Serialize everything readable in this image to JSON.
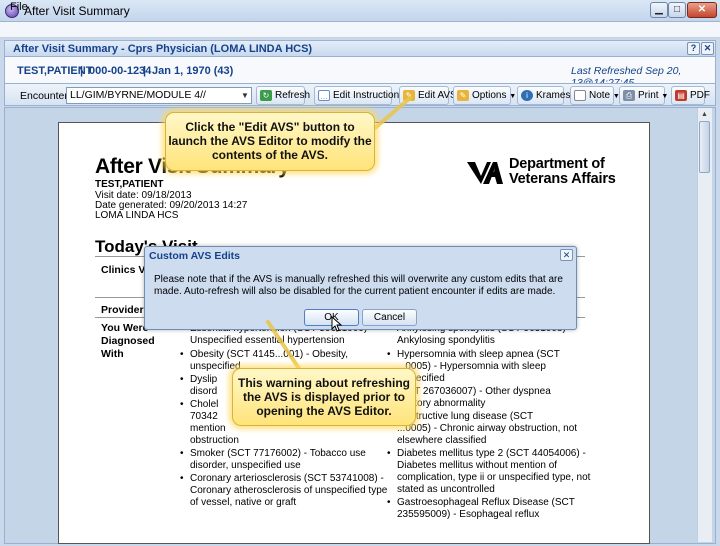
{
  "window": {
    "title": "After Visit Summary",
    "min_glyph": "▁",
    "max_glyph": "□",
    "close_glyph": "✕"
  },
  "menu": {
    "file": "File"
  },
  "panel": {
    "title": "After Visit Summary - Cprs Physician (LOMA LINDA HCS)",
    "help_glyph": "?",
    "close_glyph": "✕"
  },
  "patient": {
    "name": "TEST,PATIENT",
    "ssn": "000-00-1234",
    "dob": "Jan 1, 1970 (43)",
    "separator": "|",
    "last_refreshed": "Last Refreshed Sep 20, 13@14:27:45"
  },
  "toolbar": {
    "encounter_label": "Encounter:",
    "encounter_value": "LL/GIM/BYRNE/MODULE 4//",
    "refresh": "Refresh",
    "edit_instructions": "Edit Instructions",
    "edit_avs": "Edit AVS",
    "options": "Options",
    "krames": "Krames",
    "note": "Note",
    "print": "Print",
    "pdf": "PDF"
  },
  "document": {
    "title": "After Visit Summary",
    "patient": "TEST,PATIENT",
    "visit_date": "Visit date: 09/18/2013",
    "date_generated": "Date generated: 09/20/2013 14:27",
    "facility": "LOMA LINDA HCS",
    "va_line1": "Department of",
    "va_line2": "Veterans Affairs",
    "todays_visit": "Today's Visit",
    "clinics_label": "Clinics Vi",
    "providers_label": "Providers",
    "diagnosed_label": "You Were Diagnosed With",
    "left_col": [
      "Essential hypertension (SCT 59621000) -",
      "Unspecified essential hypertension",
      "Obesity (SCT 4145...001) - Obesity,",
      "unspecified",
      "Dyslip",
      "disord",
      "Cholel",
      "70342",
      "mention",
      "obstruction",
      "Smoker (SCT 77176002) - Tobacco use",
      "disorder, unspecified use",
      "Coronary arteriosclerosis (SCT 53741008) -",
      "Coronary atherosclerosis of unspecified type",
      "of vessel, native or graft"
    ],
    "right_col": [
      "Ankylosing spondylitis (SCT 9631008) -",
      "Ankylosing spondylitis",
      "Hypersomnia with sleep apnea (SCT",
      "...0005) - Hypersomnia with sleep",
      "...specified",
      "(SCT 267036007) - Other dyspnea",
      "...ratory abnormality",
      "...bstructive lung disease (SCT",
      "...0005) - Chronic airway obstruction, not",
      "elsewhere classified",
      "Diabetes mellitus type 2 (SCT 44054006) -",
      "Diabetes mellitus without mention of",
      "complication, type ii or unspecified type, not",
      "stated as uncontrolled",
      "Gastroesophageal Reflux Disease (SCT",
      "235595009) - Esophageal reflux"
    ]
  },
  "dialog": {
    "title": "Custom AVS Edits",
    "message": "Please note that if the AVS is manually refreshed this will overwrite any custom edits that are made. Auto-refresh will also be disabled for the current patient encounter if edits are made.",
    "ok": "OK",
    "cancel": "Cancel",
    "close_glyph": "✕"
  },
  "callouts": {
    "edit_avs_note": "Click the \"Edit AVS\" button to launch the AVS Editor to modify the contents of the AVS.",
    "warning_note": "This warning about refreshing the AVS is displayed prior to opening the AVS Editor."
  },
  "colors": {
    "accent": "#15428b",
    "callout": "#ffe47a",
    "pdf_icon": "#c0392b"
  }
}
